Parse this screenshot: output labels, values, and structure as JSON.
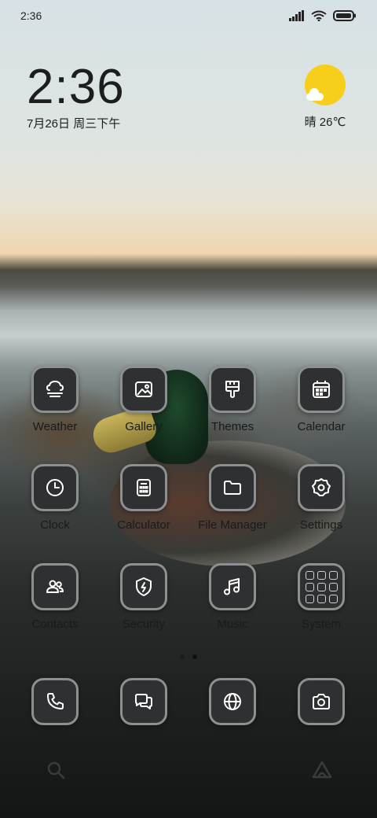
{
  "status_bar": {
    "time": "2:36",
    "icons": [
      "signal-icon",
      "wifi-icon",
      "battery-icon"
    ]
  },
  "clock_widget": {
    "time": "2:36",
    "date": "7月26日 周三下午"
  },
  "weather_widget": {
    "text": "晴 26℃",
    "icon": "sunny-cloud-icon"
  },
  "apps": [
    {
      "label": "Weather",
      "icon": "weather-icon"
    },
    {
      "label": "Gallery",
      "icon": "gallery-icon"
    },
    {
      "label": "Themes",
      "icon": "themes-icon"
    },
    {
      "label": "Calendar",
      "icon": "calendar-icon"
    },
    {
      "label": "Clock",
      "icon": "clock-icon"
    },
    {
      "label": "Calculator",
      "icon": "calculator-icon"
    },
    {
      "label": "File Manager",
      "icon": "folder-icon"
    },
    {
      "label": "Settings",
      "icon": "gear-icon"
    },
    {
      "label": "Contacts",
      "icon": "contacts-icon"
    },
    {
      "label": "Security",
      "icon": "shield-icon"
    },
    {
      "label": "Music",
      "icon": "music-icon"
    },
    {
      "label": "System",
      "icon": "system-folder-icon"
    }
  ],
  "page_indicator": {
    "pages": 2,
    "active": 2
  },
  "dock": [
    {
      "icon": "phone-icon"
    },
    {
      "icon": "messages-icon"
    },
    {
      "icon": "browser-icon"
    },
    {
      "icon": "camera-icon"
    }
  ],
  "bottom_bar": {
    "left_icon": "search-icon",
    "right_icon": "assistant-icon"
  },
  "colors": {
    "icon_bg": "#2e3031",
    "icon_border": "#8c9091",
    "sun": "#f7cf1b"
  }
}
